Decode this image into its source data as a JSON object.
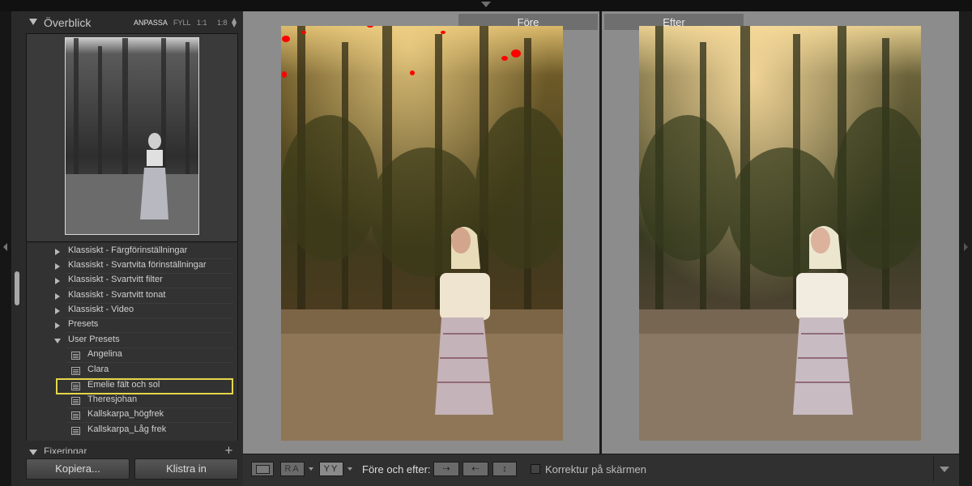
{
  "navigator": {
    "title": "Överblick",
    "zoom_options": [
      "ANPASSA",
      "FYLL",
      "1:1",
      "1:8"
    ],
    "selected_zoom": "ANPASSA"
  },
  "presets": {
    "items": [
      {
        "label": "Klassiskt - Färgförinställningar",
        "type": "folder",
        "expanded": false
      },
      {
        "label": "Klassiskt - Svartvita förinställningar",
        "type": "folder",
        "expanded": false
      },
      {
        "label": "Klassiskt - Svartvitt filter",
        "type": "folder",
        "expanded": false
      },
      {
        "label": "Klassiskt - Svartvitt tonat",
        "type": "folder",
        "expanded": false
      },
      {
        "label": "Klassiskt - Video",
        "type": "folder",
        "expanded": false
      },
      {
        "label": "Presets",
        "type": "folder",
        "expanded": false
      },
      {
        "label": "User Presets",
        "type": "folder",
        "expanded": true
      },
      {
        "label": "Angelina",
        "type": "preset"
      },
      {
        "label": "Clara",
        "type": "preset"
      },
      {
        "label": "Emelie fält och sol",
        "type": "preset",
        "highlighted": true
      },
      {
        "label": "Theresjohan",
        "type": "preset"
      },
      {
        "label": "Kallskarpa_högfrek",
        "type": "preset"
      },
      {
        "label": "Kallskarpa_Låg frek",
        "type": "preset"
      }
    ]
  },
  "snapshots": {
    "title": "Fixeringar"
  },
  "buttons": {
    "copy": "Kopiera...",
    "paste": "Klistra in"
  },
  "compare": {
    "before_label": "Före",
    "after_label": "Efter"
  },
  "toolbar": {
    "view_ra": "RA",
    "view_yy": "YY",
    "before_after_label": "Före och efter:",
    "proof_label": "Korrektur på skärmen",
    "proof_checked": false
  },
  "colors": {
    "highlight": "#e5d64a",
    "clipping": "#ff0000"
  }
}
